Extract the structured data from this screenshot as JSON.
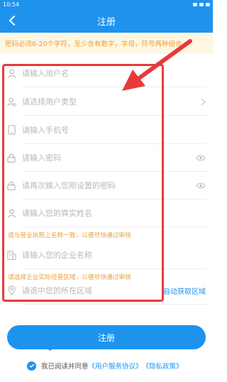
{
  "status_bar": {
    "time": "10:54"
  },
  "header": {
    "title": "注册"
  },
  "notice": {
    "text": "密码必须6-20个字符，至少含有数字，字母，符号两种组合"
  },
  "form": {
    "username_placeholder": "请输入用户名",
    "user_type_placeholder": "请选择用户类型",
    "phone_placeholder": "请输入手机号",
    "password_placeholder": "请输入密码",
    "password_confirm_placeholder": "请再次输入您刚设置的密码",
    "realname_placeholder": "请输入您的真实姓名",
    "realname_hint": "请与营业执照上名称一致，以便尽快通过审核",
    "company_placeholder": "请输入您的企业名称",
    "company_hint": "请选择企业实际经营区域，以便尽快通过审核",
    "region_placeholder": "请选中您的所在区域",
    "auto_location": "自动获取区域"
  },
  "submit": {
    "label": "注册"
  },
  "agreement": {
    "prefix": "我已阅读并同意",
    "service": "《用户服务协议》",
    "privacy": "《隐私政策》"
  },
  "colors": {
    "primary": "#1e93ee",
    "warning": "#e9a23b",
    "annotation": "#e83a3a"
  },
  "icons": [
    "back-arrow-icon",
    "user-icon",
    "user-type-icon",
    "phone-icon",
    "lock-icon",
    "eye-icon",
    "chevron-right-icon",
    "building-icon",
    "location-icon",
    "check-icon"
  ]
}
